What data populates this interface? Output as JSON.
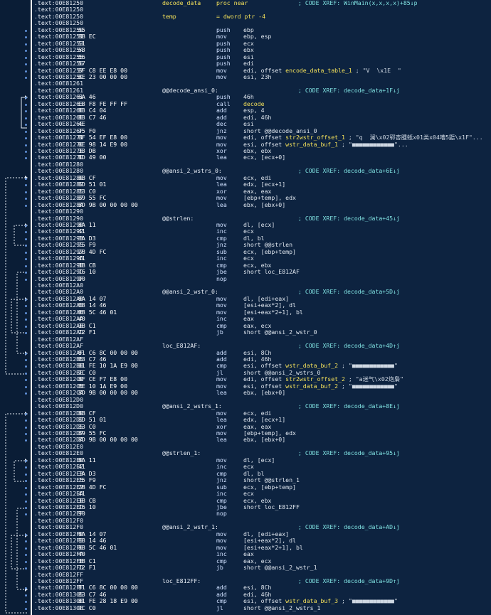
{
  "lines": [
    {
      "a": ".text:00E81250",
      "l": "decode_data",
      "lc": "yellow",
      "m": "proc near",
      "x": "; CODE XREF: WinMain(x,x,x,x)+85↓p"
    },
    {
      "a": ".text:00E81250"
    },
    {
      "a": ".text:00E81250",
      "l": "temp",
      "lc": "yellow",
      "m": "= dword ptr -4"
    },
    {
      "a": ".text:00E81250"
    },
    {
      "a": ".text:00E81250",
      "b": "55",
      "m": "push",
      "o": "ebp"
    },
    {
      "a": ".text:00E81251",
      "b": "8B EC",
      "m": "mov",
      "o": "ebp, esp"
    },
    {
      "a": ".text:00E81253",
      "b": "51",
      "m": "push",
      "o": "ecx"
    },
    {
      "a": ".text:00E81254",
      "b": "53",
      "m": "push",
      "o": "ebx"
    },
    {
      "a": ".text:00E81255",
      "b": "56",
      "m": "push",
      "o": "esi"
    },
    {
      "a": ".text:00E81256",
      "b": "57",
      "m": "push",
      "o": "edi"
    },
    {
      "a": ".text:00E81257",
      "b": "BF C8 EE E8 00",
      "m": "mov",
      "o": "edi, offset ",
      "s": "encode_data_table_1",
      "c": " ; \"V  \\x1E  \""
    },
    {
      "a": ".text:00E8125C",
      "b": "BE 23 00 00 00",
      "m": "mov",
      "o": "esi, 23h"
    },
    {
      "a": ".text:00E81261"
    },
    {
      "a": ".text:00E81261",
      "l": "@@decode_ansi_0:",
      "x": "; CODE XREF: decode_data+1F↓j"
    },
    {
      "a": ".text:00E81261",
      "b": "6A 46",
      "m": "push",
      "o": "46h"
    },
    {
      "a": ".text:00E81263",
      "b": "E8 F8 FE FF FF",
      "m": "call",
      "s": "decode"
    },
    {
      "a": ".text:00E81268",
      "b": "83 C4 04",
      "m": "add",
      "o": "esp, 4"
    },
    {
      "a": ".text:00E8126B",
      "b": "83 C7 46",
      "m": "add",
      "o": "edi, 46h"
    },
    {
      "a": ".text:00E8126E",
      "b": "4E",
      "m": "dec",
      "o": "esi"
    },
    {
      "a": ".text:00E8126F",
      "b": "75 F0",
      "m": "jnz",
      "o": "short @@decode_ansi_0"
    },
    {
      "a": ".text:00E81271",
      "b": "BF 54 EF E8 00",
      "m": "mov",
      "o": "edi, offset ",
      "s": "str2wstr_offset_1",
      "c": " ; \"q  澜\\x02郓杏腫蚳x01类x04嘈5鼯\\x1F\"..."
    },
    {
      "a": ".text:00E81276",
      "b": "BE 98 14 E9 00",
      "m": "mov",
      "o": "esi, offset ",
      "s": "wstr_data_buf_1",
      "c": " ; \"■■■■■■■■■■■■\"..."
    },
    {
      "a": ".text:00E8127B",
      "b": "33 DB",
      "m": "xor",
      "o": "ebx, ebx"
    },
    {
      "a": ".text:00E8127D",
      "b": "8D 49 00",
      "m": "lea",
      "o": "ecx, [ecx+0]"
    },
    {
      "a": ".text:00E81280"
    },
    {
      "a": ".text:00E81280",
      "l": "@@ansi_2_wstrs_0:",
      "x": "; CODE XREF: decode_data+6E↓j"
    },
    {
      "a": ".text:00E81280",
      "b": "8B CF",
      "m": "mov",
      "o": "ecx, edi"
    },
    {
      "a": ".text:00E81282",
      "b": "8D 51 01",
      "m": "lea",
      "o": "edx, [ecx+1]"
    },
    {
      "a": ".text:00E81285",
      "b": "33 C0",
      "m": "xor",
      "o": "eax, eax"
    },
    {
      "a": ".text:00E81287",
      "b": "89 55 FC",
      "m": "mov",
      "o": "[ebp+temp], edx"
    },
    {
      "a": ".text:00E8128A",
      "b": "8D 9B 00 00 00 00",
      "m": "lea",
      "o": "ebx, [ebx+0]"
    },
    {
      "a": ".text:00E81290"
    },
    {
      "a": ".text:00E81290",
      "l": "@@strlen:",
      "x": "; CODE XREF: decode_data+45↓j"
    },
    {
      "a": ".text:00E81290",
      "b": "8A 11",
      "m": "mov",
      "o": "dl, [ecx]"
    },
    {
      "a": ".text:00E81292",
      "b": "41",
      "m": "inc",
      "o": "ecx"
    },
    {
      "a": ".text:00E81293",
      "b": "3A D3",
      "m": "cmp",
      "o": "dl, bl"
    },
    {
      "a": ".text:00E81295",
      "b": "75 F9",
      "m": "jnz",
      "o": "short @@strlen"
    },
    {
      "a": ".text:00E81297",
      "b": "2B 4D FC",
      "m": "sub",
      "o": "ecx, [ebp+temp]"
    },
    {
      "a": ".text:00E8129A",
      "b": "41",
      "m": "inc",
      "o": "ecx"
    },
    {
      "a": ".text:00E8129B",
      "b": "3B CB",
      "m": "cmp",
      "o": "ecx, ebx"
    },
    {
      "a": ".text:00E8129D",
      "b": "76 10",
      "m": "jbe",
      "o": "short loc_E812AF"
    },
    {
      "a": ".text:00E8129F",
      "b": "90",
      "m": "nop"
    },
    {
      "a": ".text:00E812A0"
    },
    {
      "a": ".text:00E812A0",
      "l": "@@ansi_2_wstr_0:",
      "x": "; CODE XREF: decode_data+5D↓j"
    },
    {
      "a": ".text:00E812A0",
      "b": "8A 14 07",
      "m": "mov",
      "o": "dl, [edi+eax]"
    },
    {
      "a": ".text:00E812A3",
      "b": "88 14 46",
      "m": "mov",
      "o": "[esi+eax*2], dl"
    },
    {
      "a": ".text:00E812A6",
      "b": "88 5C 46 01",
      "m": "mov",
      "o": "[esi+eax*2+1], bl"
    },
    {
      "a": ".text:00E812AA",
      "b": "40",
      "m": "inc",
      "o": "eax"
    },
    {
      "a": ".text:00E812AB",
      "b": "3B C1",
      "m": "cmp",
      "o": "eax, ecx"
    },
    {
      "a": ".text:00E812AD",
      "b": "72 F1",
      "m": "jb",
      "o": "short @@ansi_2_wstr_0"
    },
    {
      "a": ".text:00E812AF"
    },
    {
      "a": ".text:00E812AF",
      "l": "loc_E812AF:",
      "x": "; CODE XREF: decode_data+4D↑j"
    },
    {
      "a": ".text:00E812AF",
      "b": "81 C6 8C 00 00 00",
      "m": "add",
      "o": "esi, 8Ch"
    },
    {
      "a": ".text:00E812B5",
      "b": "83 C7 46",
      "m": "add",
      "o": "edi, 46h"
    },
    {
      "a": ".text:00E812B8",
      "b": "81 FE 10 1A E9 00",
      "m": "cmp",
      "o": "esi, offset ",
      "s": "wstr_data_buf_2",
      "c": " ; \"■■■■■■■■■■■■\""
    },
    {
      "a": ".text:00E812BE",
      "b": "7C C0",
      "m": "jl",
      "o": "short @@ansi_2_wstrs_0"
    },
    {
      "a": ".text:00E812C0",
      "b": "BF CE F7 E8 00",
      "m": "mov",
      "o": "edi, offset ",
      "s": "str2wstr_offset_2",
      "c": " ; \"a迷气\\x02炮梟\""
    },
    {
      "a": ".text:00E812C5",
      "b": "BE 10 1A E9 00",
      "m": "mov",
      "o": "esi, offset ",
      "s": "wstr_data_buf_2",
      "c": " ; \"■■■■■■■■■■■■\""
    },
    {
      "a": ".text:00E812CA",
      "b": "8D 9B 00 00 00 00",
      "m": "lea",
      "o": "ebx, [ebx+0]"
    },
    {
      "a": ".text:00E812D0"
    },
    {
      "a": ".text:00E812D0",
      "l": "@@ansi_2_wstrs_1:",
      "x": "; CODE XREF: decode_data+8E↓j"
    },
    {
      "a": ".text:00E812D0",
      "b": "8B CF",
      "m": "mov",
      "o": "ecx, edi"
    },
    {
      "a": ".text:00E812D2",
      "b": "8D 51 01",
      "m": "lea",
      "o": "edx, [ecx+1]"
    },
    {
      "a": ".text:00E812D5",
      "b": "33 C0",
      "m": "xor",
      "o": "eax, eax"
    },
    {
      "a": ".text:00E812D7",
      "b": "89 55 FC",
      "m": "mov",
      "o": "[ebp+temp], edx"
    },
    {
      "a": ".text:00E812DA",
      "b": "8D 9B 00 00 00 00",
      "m": "lea",
      "o": "ebx, [ebx+0]"
    },
    {
      "a": ".text:00E812E0"
    },
    {
      "a": ".text:00E812E0",
      "l": "@@strlen_1:",
      "x": "; CODE XREF: decode_data+95↓j"
    },
    {
      "a": ".text:00E812E0",
      "b": "8A 11",
      "m": "mov",
      "o": "dl, [ecx]"
    },
    {
      "a": ".text:00E812E2",
      "b": "41",
      "m": "inc",
      "o": "ecx"
    },
    {
      "a": ".text:00E812E3",
      "b": "3A D3",
      "m": "cmp",
      "o": "dl, bl"
    },
    {
      "a": ".text:00E812E5",
      "b": "75 F9",
      "m": "jnz",
      "o": "short @@strlen_1"
    },
    {
      "a": ".text:00E812E7",
      "b": "2B 4D FC",
      "m": "sub",
      "o": "ecx, [ebp+temp]"
    },
    {
      "a": ".text:00E812EA",
      "b": "41",
      "m": "inc",
      "o": "ecx"
    },
    {
      "a": ".text:00E812EB",
      "b": "3B CB",
      "m": "cmp",
      "o": "ecx, ebx"
    },
    {
      "a": ".text:00E812ED",
      "b": "76 10",
      "m": "jbe",
      "o": "short loc_E812FF"
    },
    {
      "a": ".text:00E812EF",
      "b": "90",
      "m": "nop"
    },
    {
      "a": ".text:00E812F0"
    },
    {
      "a": ".text:00E812F0",
      "l": "@@ansi_2_wstr_1:",
      "x": "; CODE XREF: decode_data+AD↓j"
    },
    {
      "a": ".text:00E812F0",
      "b": "8A 14 07",
      "m": "mov",
      "o": "dl, [edi+eax]"
    },
    {
      "a": ".text:00E812F3",
      "b": "88 14 46",
      "m": "mov",
      "o": "[esi+eax*2], dl"
    },
    {
      "a": ".text:00E812F6",
      "b": "88 5C 46 01",
      "m": "mov",
      "o": "[esi+eax*2+1], bl"
    },
    {
      "a": ".text:00E812FA",
      "b": "40",
      "m": "inc",
      "o": "eax"
    },
    {
      "a": ".text:00E812FB",
      "b": "3B C1",
      "m": "cmp",
      "o": "eax, ecx"
    },
    {
      "a": ".text:00E812FD",
      "b": "72 F1",
      "m": "jb",
      "o": "short @@ansi_2_wstr_1"
    },
    {
      "a": ".text:00E812FF"
    },
    {
      "a": ".text:00E812FF",
      "l": "loc_E812FF:",
      "x": "; CODE XREF: decode_data+9D↑j"
    },
    {
      "a": ".text:00E812FF",
      "b": "81 C6 8C 00 00 00",
      "m": "add",
      "o": "esi, 8Ch"
    },
    {
      "a": ".text:00E81305",
      "b": "83 C7 46",
      "m": "add",
      "o": "edi, 46h"
    },
    {
      "a": ".text:00E81308",
      "b": "81 FE 28 18 E9 00",
      "m": "cmp",
      "o": "esi, offset ",
      "s": "wstr_data_buf_3",
      "c": " ; \"■■■■■■■■■■■■\""
    },
    {
      "a": ".text:00E8130E",
      "b": "7C C0",
      "m": "jl",
      "o": "short @@ansi_2_wstrs_1"
    }
  ],
  "colors": {
    "background": "#0d2340",
    "gutter": "#0a1d36",
    "symbol": "#f3e05a",
    "xref": "#7fe0e0",
    "breakpoint": "#5f8fd6"
  }
}
